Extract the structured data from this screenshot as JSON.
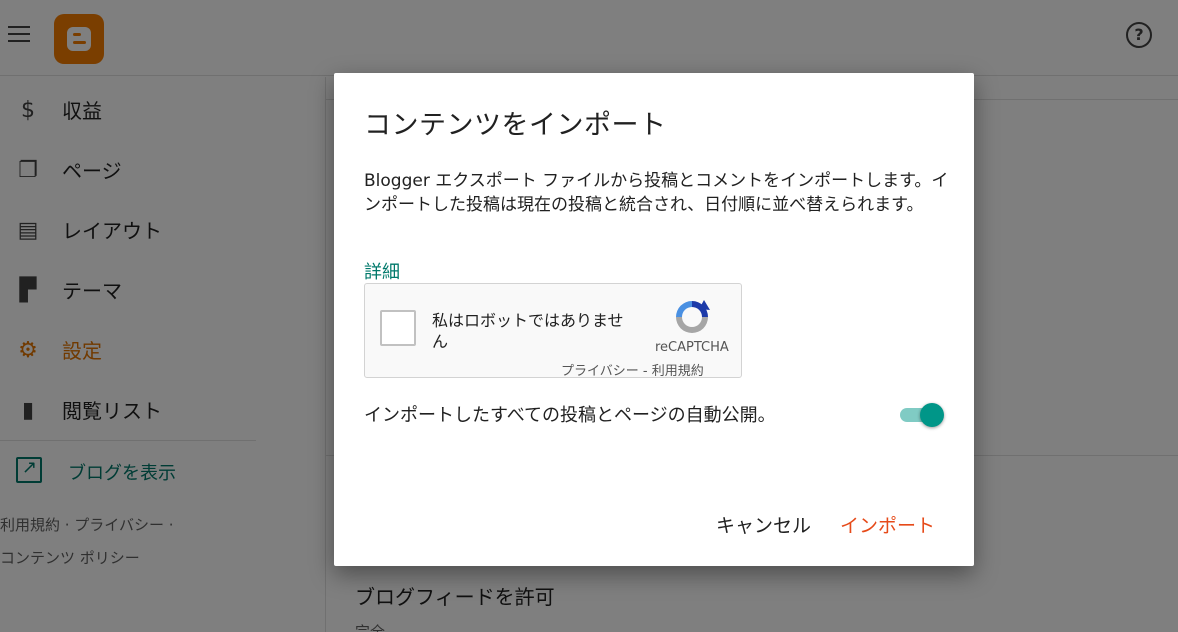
{
  "sidebar": {
    "items": [
      {
        "label": "収益",
        "icon": "dollar-icon"
      },
      {
        "label": "ページ",
        "icon": "pages-icon"
      },
      {
        "label": "レイアウト",
        "icon": "layout-icon"
      },
      {
        "label": "テーマ",
        "icon": "paint-roller-icon"
      },
      {
        "label": "設定",
        "icon": "gear-icon"
      },
      {
        "label": "閲覧リスト",
        "icon": "bookmark-icon"
      }
    ],
    "view_blog": "ブログを表示",
    "footer_line1": "利用規約 · プライバシー ·",
    "footer_line2": "コンテンツ ポリシー"
  },
  "content": {
    "heading": "ブログフィードを許可",
    "sub": "完全"
  },
  "dialog": {
    "title": "コンテンツをインポート",
    "description": "Blogger エクスポート ファイルから投稿とコメントをインポートします。インポートした投稿は現在の投稿と統合され、日付順に並べ替えられます。",
    "link": "詳細",
    "captcha": {
      "label": "私はロボットではありません",
      "brand": "reCAPTCHA",
      "terms": "プライバシー - 利用規約"
    },
    "auto_publish_label": "インポートしたすべての投稿とページの自動公開。",
    "auto_publish_on": true,
    "cancel": "キャンセル",
    "import": "インポート"
  },
  "colors": {
    "accent_orange": "#e37400",
    "teal": "#00796b",
    "import_button": "#e64a19"
  }
}
